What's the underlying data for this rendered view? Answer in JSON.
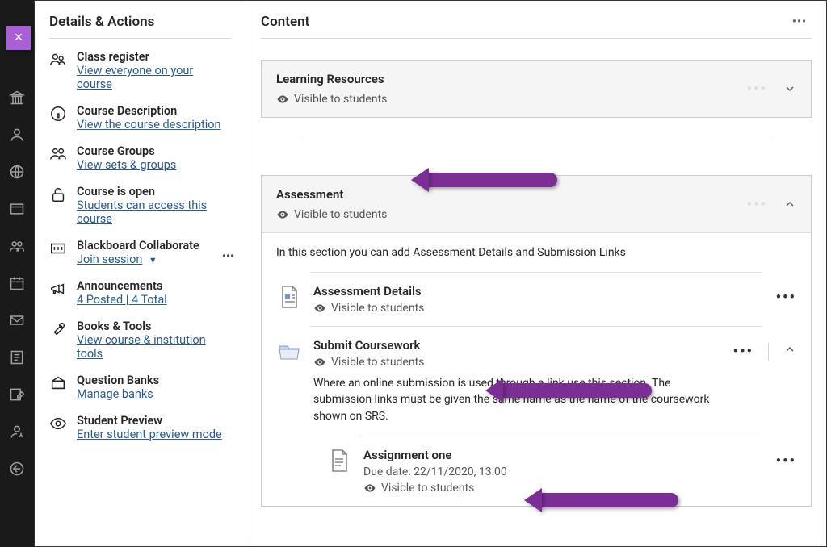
{
  "close_icon": "✕",
  "rail": {
    "items": [
      {
        "name": "institution"
      },
      {
        "name": "profile"
      },
      {
        "name": "activity"
      },
      {
        "name": "courses"
      },
      {
        "name": "organisations"
      },
      {
        "name": "calendar"
      },
      {
        "name": "messages"
      },
      {
        "name": "grades"
      },
      {
        "name": "tools"
      },
      {
        "name": "admin"
      },
      {
        "name": "signout"
      }
    ]
  },
  "details": {
    "heading": "Details & Actions",
    "items": [
      {
        "key": "class-register",
        "title": "Class register",
        "link": "View everyone on your course"
      },
      {
        "key": "course-description",
        "title": "Course Description",
        "link": "View the course description"
      },
      {
        "key": "course-groups",
        "title": "Course Groups",
        "link": "View sets & groups"
      },
      {
        "key": "course-open",
        "title": "Course is open",
        "link": "Students can access this course"
      },
      {
        "key": "collaborate",
        "title": "Blackboard Collaborate",
        "link": "Join session",
        "has_dropdown": true,
        "has_ellipsis": true
      },
      {
        "key": "announcements",
        "title": "Announcements",
        "link": "4 Posted | 4 Total"
      },
      {
        "key": "books-tools",
        "title": "Books & Tools",
        "link": "View course & institution tools"
      },
      {
        "key": "question-banks",
        "title": "Question Banks",
        "link": "Manage banks"
      },
      {
        "key": "student-preview",
        "title": "Student Preview",
        "link": "Enter student preview mode"
      }
    ]
  },
  "content": {
    "heading": "Content",
    "visible_label": "Visible to students",
    "folders": [
      {
        "title": "Learning Resources",
        "expanded": false
      },
      {
        "title": "Assessment",
        "expanded": true,
        "description": "In this section you can add Assessment Details and Submission Links",
        "items": [
          {
            "kind": "document",
            "title": "Assessment Details"
          },
          {
            "kind": "folder",
            "title": "Submit Coursework",
            "expanded": true,
            "description": "Where an online submission is used through a link use this section. The submission links must be given the same name as the name of the coursework shown on SRS.",
            "children": [
              {
                "kind": "assignment",
                "title": "Assignment one",
                "due": "Due date: 22/11/2020, 13:00"
              }
            ]
          }
        ]
      }
    ]
  }
}
